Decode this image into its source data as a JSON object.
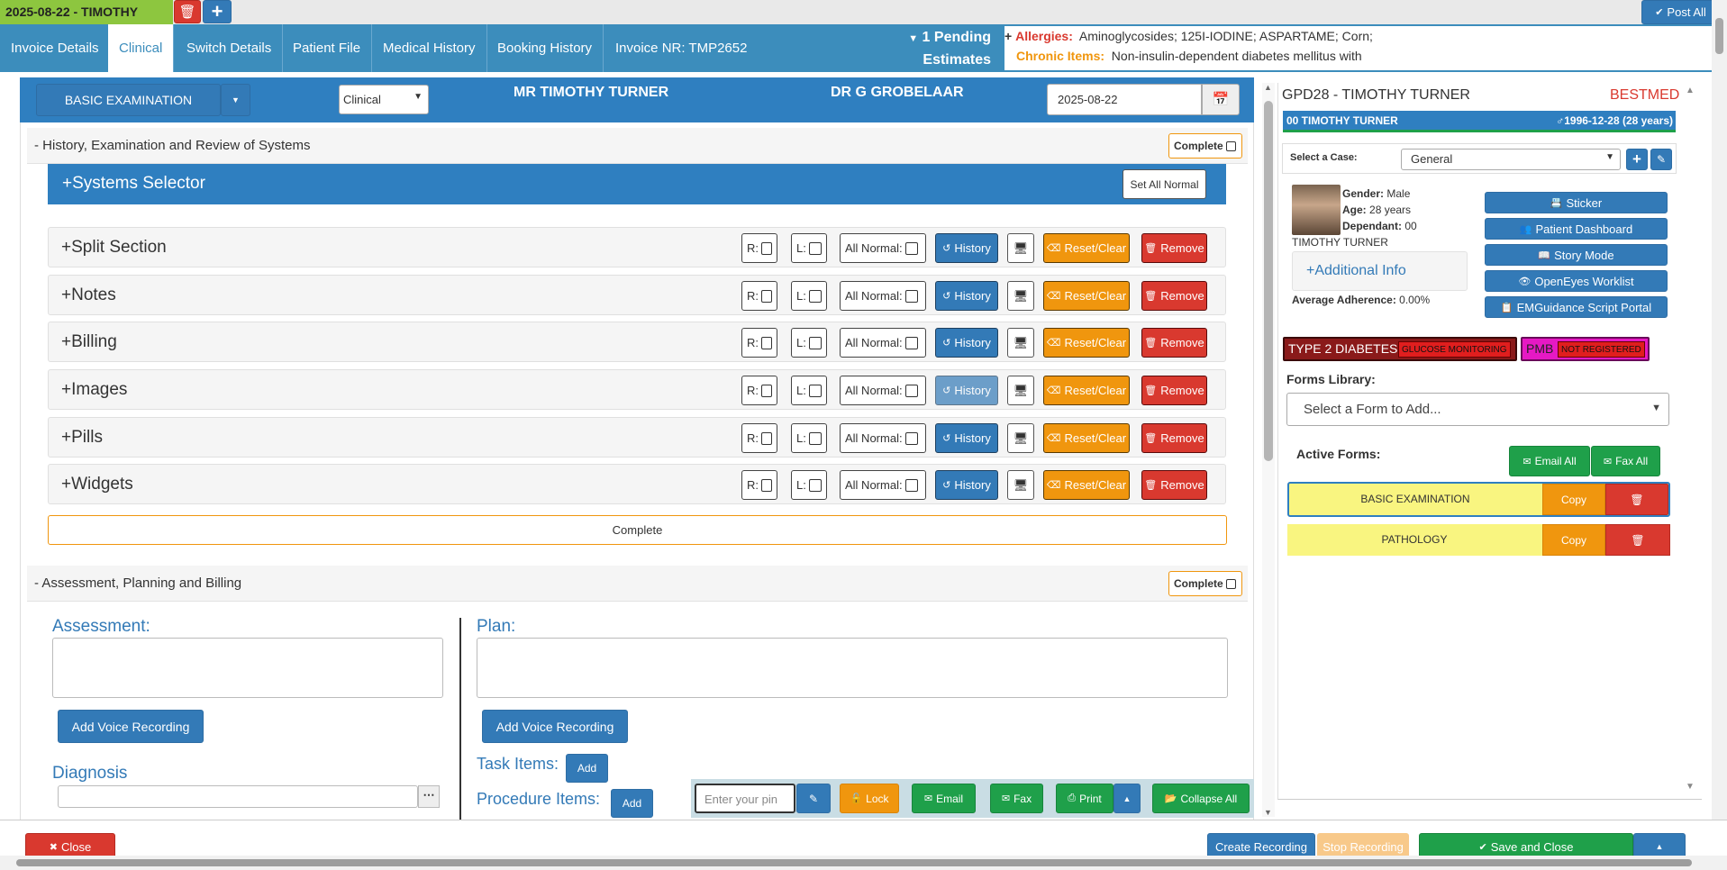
{
  "topbar": {
    "session_tab": "2025-08-22 - TIMOTHY",
    "post_all": "Post All"
  },
  "nav": {
    "tabs": [
      "Invoice Details",
      "Clinical",
      "Switch Details",
      "Patient File",
      "Medical History",
      "Booking History",
      "Invoice NR: TMP2652"
    ],
    "active_tab": "Clinical",
    "pending_line1": "1 Pending",
    "pending_line2": "Estimates",
    "allergies_label": "Allergies:",
    "allergies_value": "Aminoglycosides; 125I-IODINE; ASPARTAME; Corn;",
    "chronic_label": "Chronic Items:",
    "chronic_value": "Non-insulin-dependent diabetes mellitus with"
  },
  "form_header": {
    "form_name": "BASIC EXAMINATION",
    "type_select": "Clinical",
    "patient_name": "MR TIMOTHY TURNER",
    "doctor": "DR G GROBELAAR",
    "date": "2025-08-22"
  },
  "history_section": {
    "title": "History, Examination and Review of Systems",
    "complete_label": "Complete",
    "systems_selector": "Systems Selector",
    "set_all_normal": "Set All Normal",
    "rows": [
      {
        "title": "Split Section"
      },
      {
        "title": "Notes"
      },
      {
        "title": "Billing"
      },
      {
        "title": "Images"
      },
      {
        "title": "Pills"
      },
      {
        "title": "Widgets"
      }
    ],
    "r_label": "R:",
    "l_label": "L:",
    "all_normal_label": "All Normal:",
    "history_label": "History",
    "reset_label": "Reset/Clear",
    "remove_label": "Remove",
    "complete_button": "Complete"
  },
  "assessment_section": {
    "title": "Assessment, Planning and Billing",
    "complete_label": "Complete",
    "assessment_label": "Assessment:",
    "plan_label": "Plan:",
    "voice_recording": "Add Voice Recording",
    "diagnosis_label": "Diagnosis",
    "task_items": "Task Items:",
    "procedure_items": "Procedure Items:",
    "add": "Add"
  },
  "float_toolbar": {
    "pin_placeholder": "Enter your pin",
    "lock": "Lock",
    "email": "Email",
    "fax": "Fax",
    "print": "Print",
    "collapse_all": "Collapse All"
  },
  "right_panel": {
    "title": "GPD28 - TIMOTHY TURNER",
    "scheme": "BESTMED",
    "patient_bar": "00 TIMOTHY TURNER",
    "dob": "1996-12-28 (28 years)",
    "select_case_label": "Select a Case:",
    "case_value": "General",
    "gender_label": "Gender:",
    "gender": "Male",
    "age_label": "Age:",
    "age": "28 years",
    "dependant_label": "Dependant:",
    "dependant": "00",
    "patient_name": "TIMOTHY TURNER",
    "additional_info": "Additional Info",
    "adherence_label": "Average Adherence:",
    "adherence": "0.00%",
    "actions": [
      "Sticker",
      "Patient Dashboard",
      "Story Mode",
      "OpenEyes Worklist",
      "EMGuidance Script Portal"
    ],
    "badge1": "TYPE 2 DIABETES",
    "badge1_sub": "GLUCOSE MONITORING",
    "badge2": "PMB",
    "badge2_sub": "NOT REGISTERED",
    "forms_library_label": "Forms Library:",
    "forms_library_placeholder": "Select a Form to Add...",
    "active_forms_label": "Active Forms:",
    "email_all": "Email All",
    "fax_all": "Fax All",
    "forms": [
      {
        "name": "BASIC EXAMINATION",
        "copy": "Copy"
      },
      {
        "name": "PATHOLOGY",
        "copy": "Copy"
      }
    ]
  },
  "footer": {
    "close": "Close",
    "create_recording": "Create Recording",
    "stop_recording": "Stop Recording",
    "save_and_close": "Save and Close"
  }
}
